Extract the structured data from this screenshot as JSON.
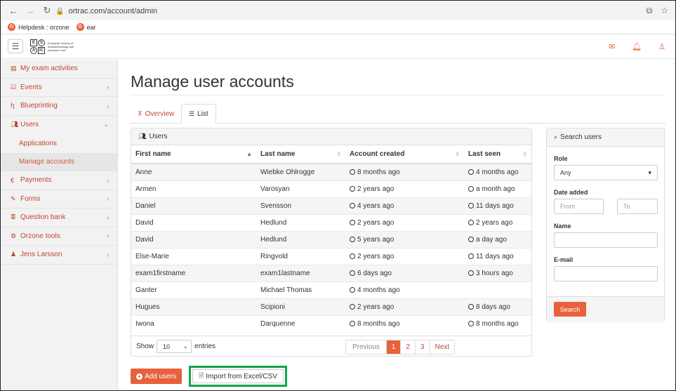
{
  "browser": {
    "url": "ortrac.com/account/admin",
    "bookmarks": [
      {
        "label": "Helpdesk : orzone"
      },
      {
        "label": "ear"
      }
    ]
  },
  "header": {
    "logo_text": "European Society of Anaesthesiology and Intensive Care",
    "logo_letters": [
      "E",
      "S",
      "A",
      "IC"
    ]
  },
  "sidebar": {
    "items": [
      {
        "label": "My exam activities"
      },
      {
        "label": "Events"
      },
      {
        "label": "Blueprinting"
      },
      {
        "label": "Users"
      },
      {
        "label": "Payments"
      },
      {
        "label": "Forms"
      },
      {
        "label": "Question bank"
      },
      {
        "label": "Orzone tools"
      },
      {
        "label": "Jens Larsson"
      }
    ],
    "users_sub": [
      {
        "label": "Applications"
      },
      {
        "label": "Manage accounts"
      }
    ]
  },
  "main": {
    "title": "Manage user accounts",
    "tabs": [
      {
        "label": "Overview"
      },
      {
        "label": "List"
      }
    ],
    "users_panel": {
      "title": "Users",
      "columns": [
        "First name",
        "Last name",
        "Account created",
        "Last seen"
      ],
      "rows": [
        {
          "first": "Anne",
          "last": "Wiebke Ohlrogge",
          "created": "8 months ago",
          "seen": "4 months ago"
        },
        {
          "first": "Armen",
          "last": "Varosyan",
          "created": "2 years ago",
          "seen": "a month ago"
        },
        {
          "first": "Daniel",
          "last": "Svensson",
          "created": "4 years ago",
          "seen": "11 days ago"
        },
        {
          "first": "David",
          "last": "Hedlund",
          "created": "2 years ago",
          "seen": "2 years ago"
        },
        {
          "first": "David",
          "last": "Hedlund",
          "created": "5 years ago",
          "seen": "a day ago"
        },
        {
          "first": "Else-Marie",
          "last": "Ringvold",
          "created": "2 years ago",
          "seen": "11 days ago"
        },
        {
          "first": "exam1firstname",
          "last": "exam1lastname",
          "created": "6 days ago",
          "seen": "3 hours ago"
        },
        {
          "first": "Ganter",
          "last": "Michael Thomas",
          "created": "4 months ago",
          "seen": ""
        },
        {
          "first": "Hugues",
          "last": "Scipioni",
          "created": "2 years ago",
          "seen": "8 days ago"
        },
        {
          "first": "Iwona",
          "last": "Darquenne",
          "created": "8 months ago",
          "seen": "8 months ago"
        }
      ],
      "show_label": "Show",
      "entries_value": "10",
      "entries_label": "entries",
      "pagination": [
        "Previous",
        "1",
        "2",
        "3",
        "Next"
      ]
    },
    "search_panel": {
      "title": "Search users",
      "role_label": "Role",
      "role_value": "Any",
      "date_label": "Date added",
      "from_placeholder": "From",
      "to_placeholder": "To",
      "name_label": "Name",
      "email_label": "E-mail",
      "search_button": "Search"
    },
    "actions": {
      "add_users": "Add users",
      "import": "Import from Excel/CSV"
    }
  }
}
